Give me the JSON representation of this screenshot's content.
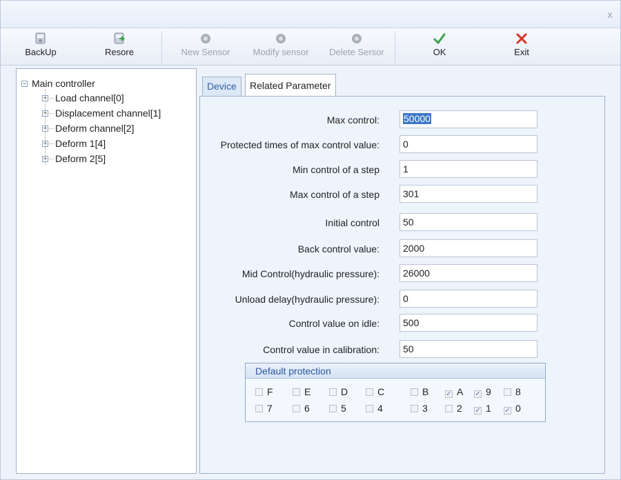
{
  "window": {
    "close_glyph": "x"
  },
  "toolbar": {
    "backup": {
      "label": "BackUp",
      "icon": "backup-disk-icon"
    },
    "restore": {
      "label": "Resore",
      "icon": "restore-disk-icon"
    },
    "new_sensor": {
      "label": "New Sensor",
      "icon": "gear-icon"
    },
    "modify_sensor": {
      "label": "Modify sensor",
      "icon": "gear-icon"
    },
    "delete_sensor": {
      "label": "Delete Sersor",
      "icon": "gear-icon"
    },
    "ok": {
      "label": "OK",
      "icon": "checkmark-icon",
      "color": "#3aa14a"
    },
    "exit": {
      "label": "Exit",
      "icon": "close-icon",
      "color": "#d93025"
    }
  },
  "tree": {
    "root": "Main controller",
    "children": [
      "Load channel[0]",
      "Displacement channel[1]",
      "Deform channel[2]",
      "Deform 1[4]",
      "Deform 2[5]"
    ]
  },
  "tabs": [
    {
      "label": "Device",
      "active": false
    },
    {
      "label": "Related Parameter",
      "active": true
    }
  ],
  "params": [
    {
      "label": "Max control:",
      "value": "50000"
    },
    {
      "label": "Protected times of max control value:",
      "value": "0"
    },
    {
      "label": "Min control of a step",
      "value": "1"
    },
    {
      "label": "Max control of a step",
      "value": "301"
    },
    {
      "label": "Initial control",
      "value": "50"
    },
    {
      "label": "Back control value:",
      "value": "2000"
    },
    {
      "label": "Mid Control(hydraulic pressure):",
      "value": "26000"
    },
    {
      "label": "Unload delay(hydraulic pressure):",
      "value": "0"
    },
    {
      "label": "Control value on idle:",
      "value": "500"
    },
    {
      "label": "Control value  in calibration:",
      "value": "50"
    }
  ],
  "protection": {
    "title": "Default protection",
    "rows": [
      [
        {
          "label": "F",
          "checked": false
        },
        {
          "label": "E",
          "checked": false
        },
        {
          "label": "D",
          "checked": false
        },
        {
          "label": "C",
          "checked": false
        },
        {
          "label": "B",
          "checked": false
        },
        {
          "label": "A",
          "checked": true
        },
        {
          "label": "9",
          "checked": true
        },
        {
          "label": "8",
          "checked": false
        }
      ],
      [
        {
          "label": "7",
          "checked": false
        },
        {
          "label": "6",
          "checked": false
        },
        {
          "label": "5",
          "checked": false
        },
        {
          "label": "4",
          "checked": false
        },
        {
          "label": "3",
          "checked": false
        },
        {
          "label": "2",
          "checked": false
        },
        {
          "label": "1",
          "checked": true
        },
        {
          "label": "0",
          "checked": true
        }
      ]
    ]
  }
}
